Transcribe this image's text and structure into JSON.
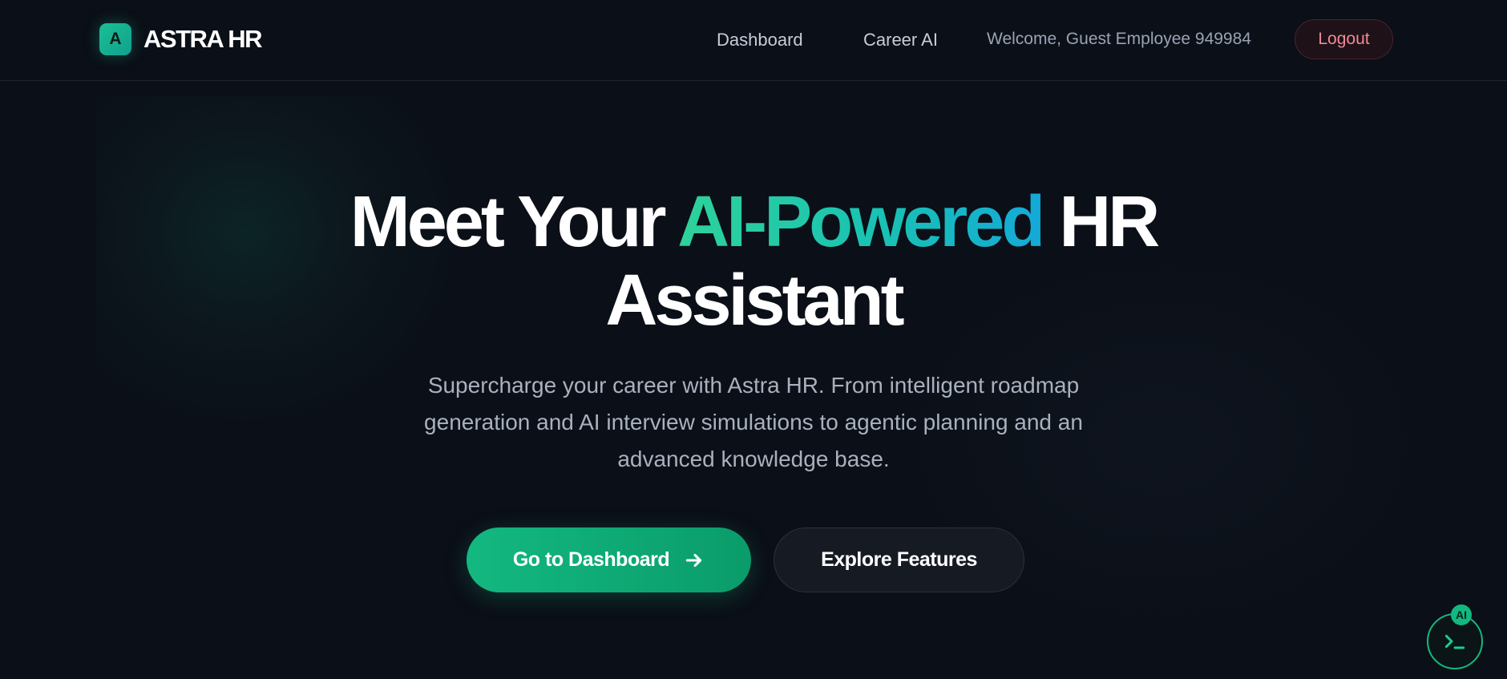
{
  "header": {
    "logo_letter": "A",
    "logo_text": "ASTRA HR",
    "nav": [
      {
        "label": "Dashboard"
      },
      {
        "label": "Career AI"
      }
    ],
    "welcome": "Welcome, Guest Employee 949984",
    "logout_label": "Logout"
  },
  "hero": {
    "title_part1": "Meet Your ",
    "title_highlight": "AI-Powered",
    "title_part2": " HR",
    "title_line2": "Assistant",
    "subtitle": "Supercharge your career with Astra HR. From intelligent roadmap generation and AI interview simulations to agentic planning and an advanced knowledge base.",
    "primary_button": "Go to Dashboard",
    "secondary_button": "Explore Features"
  },
  "assistant": {
    "badge": "AI",
    "icon": "terminal-icon"
  },
  "colors": {
    "background": "#0b0f17",
    "accent": "#13b880",
    "gradient_start": "#2fd29a",
    "gradient_end": "#14a9d8",
    "logout_text": "#f08a98"
  }
}
